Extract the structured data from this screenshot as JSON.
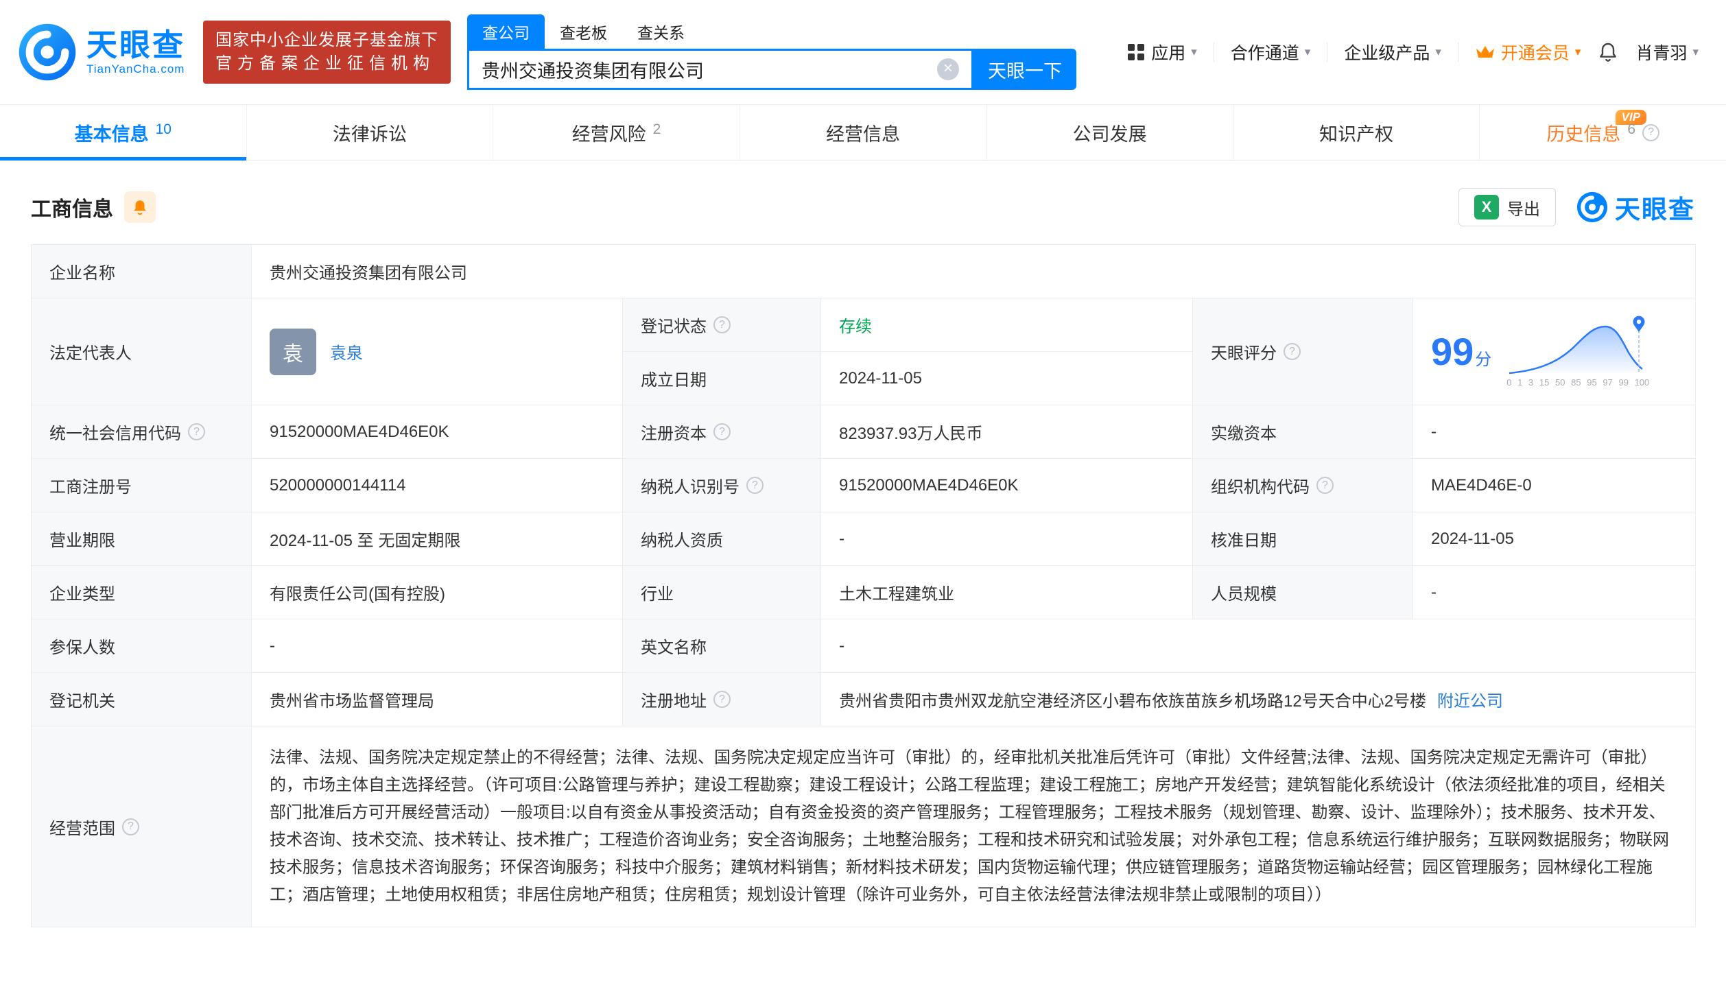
{
  "colors": {
    "brand_blue": "#0084ff",
    "vip_orange": "#ff7d00",
    "badge_red": "#c23a2c",
    "status_green": "#00a854",
    "score_blue": "#2979f8",
    "link_blue": "#2c7fd6"
  },
  "brand": {
    "name": "天眼查",
    "domain": "TianYanCha.com",
    "badge_line1": "国家中小企业发展子基金旗下",
    "badge_line2": "官方备案企业征信机构"
  },
  "search": {
    "tabs": [
      {
        "label": "查公司",
        "active": true
      },
      {
        "label": "查老板",
        "active": false
      },
      {
        "label": "查关系",
        "active": false
      }
    ],
    "value": "贵州交通投资集团有限公司",
    "button": "天眼一下"
  },
  "nav": {
    "apps": "应用",
    "cooperation": "合作通道",
    "enterprise": "企业级产品",
    "vip": "开通会员",
    "user": "肖青羽"
  },
  "tabs": [
    {
      "label": "基本信息",
      "count": "10"
    },
    {
      "label": "法律诉讼",
      "count": ""
    },
    {
      "label": "经营风险",
      "count": "2"
    },
    {
      "label": "经营信息",
      "count": ""
    },
    {
      "label": "公司发展",
      "count": ""
    },
    {
      "label": "知识产权",
      "count": ""
    },
    {
      "label": "历史信息",
      "count": "6",
      "vip": "VIP"
    }
  ],
  "section": {
    "title": "工商信息",
    "export_label": "导出",
    "watermark": "天眼查"
  },
  "table": {
    "company_name": {
      "label": "企业名称",
      "value": "贵州交通投资集团有限公司"
    },
    "legal_rep": {
      "label": "法定代表人",
      "avatar": "袁",
      "name": "袁泉"
    },
    "reg_status": {
      "label": "登记状态",
      "value": "存续"
    },
    "establish_date": {
      "label": "成立日期",
      "value": "2024-11-05"
    },
    "score": {
      "label": "天眼评分",
      "value": "99",
      "unit": "分",
      "axis": [
        "0",
        "1",
        "3",
        "15",
        "50",
        "85",
        "95",
        "97",
        "99",
        "100"
      ]
    },
    "credit_code": {
      "label": "统一社会信用代码",
      "value": "91520000MAE4D46E0K"
    },
    "reg_capital": {
      "label": "注册资本",
      "value": "823937.93万人民币"
    },
    "paid_capital": {
      "label": "实缴资本",
      "value": "-"
    },
    "reg_number": {
      "label": "工商注册号",
      "value": "520000000144114"
    },
    "taxpayer_id": {
      "label": "纳税人识别号",
      "value": "91520000MAE4D46E0K"
    },
    "org_code": {
      "label": "组织机构代码",
      "value": "MAE4D46E-0"
    },
    "business_term": {
      "label": "营业期限",
      "value": "2024-11-05 至 无固定期限"
    },
    "taxpayer_quality": {
      "label": "纳税人资质",
      "value": "-"
    },
    "approval_date": {
      "label": "核准日期",
      "value": "2024-11-05"
    },
    "company_type": {
      "label": "企业类型",
      "value": "有限责任公司(国有控股)"
    },
    "industry": {
      "label": "行业",
      "value": "土木工程建筑业"
    },
    "staff_size": {
      "label": "人员规模",
      "value": "-"
    },
    "insured_count": {
      "label": "参保人数",
      "value": "-"
    },
    "english_name": {
      "label": "英文名称",
      "value": "-"
    },
    "reg_authority": {
      "label": "登记机关",
      "value": "贵州省市场监督管理局"
    },
    "reg_address": {
      "label": "注册地址",
      "value": "贵州省贵阳市贵州双龙航空港经济区小碧布依族苗族乡机场路12号天合中心2号楼",
      "link": "附近公司"
    },
    "business_scope": {
      "label": "经营范围",
      "value": "法律、法规、国务院决定规定禁止的不得经营；法律、法规、国务院决定规定应当许可（审批）的，经审批机关批准后凭许可（审批）文件经营;法律、法规、国务院决定规定无需许可（审批）的，市场主体自主选择经营。（许可项目:公路管理与养护；建设工程勘察；建设工程设计；公路工程监理；建设工程施工；房地产开发经营；建筑智能化系统设计（依法须经批准的项目，经相关部门批准后方可开展经营活动）一般项目:以自有资金从事投资活动；自有资金投资的资产管理服务；工程管理服务；工程技术服务（规划管理、勘察、设计、监理除外）；技术服务、技术开发、技术咨询、技术交流、技术转让、技术推广；工程造价咨询业务；安全咨询服务；土地整治服务；工程和技术研究和试验发展；对外承包工程；信息系统运行维护服务；互联网数据服务；物联网技术服务；信息技术咨询服务；环保咨询服务；科技中介服务；建筑材料销售；新材料技术研发；国内货物运输代理；供应链管理服务；道路货物运输站经营；园区管理服务；园林绿化工程施工；酒店管理；土地使用权租赁；非居住房地产租赁；住房租赁；规划设计管理（除许可业务外，可自主依法经营法律法规非禁止或限制的项目））"
    }
  }
}
